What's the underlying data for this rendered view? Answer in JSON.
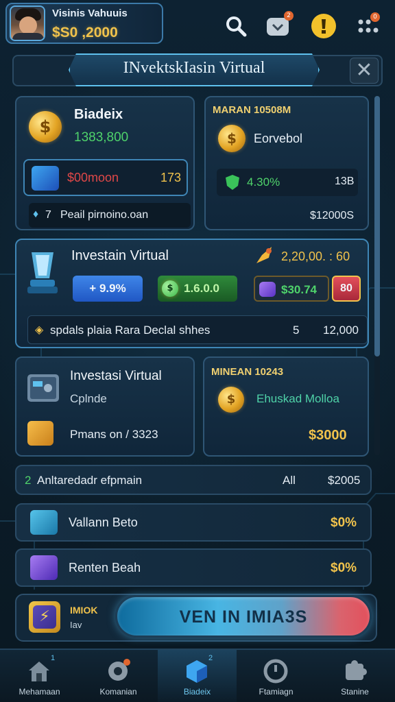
{
  "profile": {
    "name": "Visinis Vahuuis",
    "balance": "$S0 ,2000",
    "mail_badge": "2",
    "more_badge": "0"
  },
  "title": "INvektskIasin Virtual",
  "card_top_left": {
    "title": "Biadeix",
    "amount": "1383,800",
    "field_value": "$00moon",
    "field_count": "173",
    "info_number": "7",
    "info_text": "Peail pirnoino.oan"
  },
  "card_top_right": {
    "header": "MARAN 10508M",
    "name": "Eorvebol",
    "percent": "4.30%",
    "tag": "13B",
    "amount": "$12000S"
  },
  "featured": {
    "title": "Investain Virtual",
    "value": "2,20,00. : 60",
    "chip_blue": "+  9.9%",
    "chip_green": "1.6.0.0",
    "chip_purple": "$30.74",
    "chip_red": "80",
    "footer_text": "spdals plaia Rara Declal shhes",
    "footer_num": "5",
    "footer_amount": "12,000"
  },
  "card_mid_left": {
    "title": "Investasi Virtual",
    "subtitle": "Cplnde",
    "info": "Pmans on / 3323"
  },
  "card_mid_right": {
    "header": "MINEAN 10243",
    "name": "Ehuskad Molloa",
    "amount": "$3000"
  },
  "summary_row": {
    "num": "2",
    "text": "Anltaredadr efpmain",
    "label": "All",
    "amount": "$2005"
  },
  "list_rows": [
    {
      "name": "Vallann Beto",
      "value": "$0%"
    },
    {
      "name": "Renten Beah",
      "value": "$0%"
    }
  ],
  "action": {
    "label_top": "IMIOK",
    "label_bottom": "Iav",
    "button": "VEN IN IMIA3S"
  },
  "nav": [
    {
      "label": "Mehamaan",
      "badge": "1"
    },
    {
      "label": "Komanian",
      "badge": ""
    },
    {
      "label": "Biadeix",
      "badge": "2"
    },
    {
      "label": "Ftamiagn",
      "badge": ""
    },
    {
      "label": "Stanine",
      "badge": ""
    }
  ],
  "colors": {
    "accent": "#5fc1ee",
    "gold": "#f1c34c",
    "green": "#4fd36b",
    "red": "#e3505c"
  }
}
